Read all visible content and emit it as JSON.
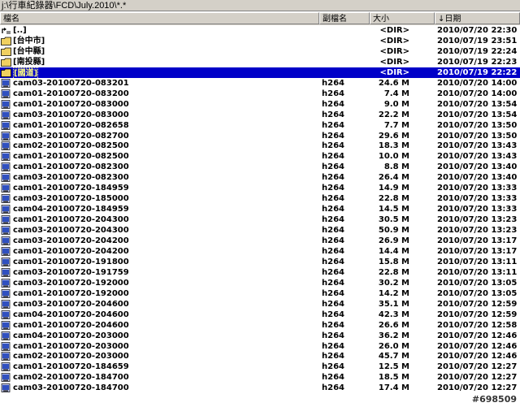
{
  "path": "j:\\行車紀錄器\\FCD\\July.2010\\*.*",
  "columns": {
    "name": "檔名",
    "ext": "副檔名",
    "size": "大小",
    "date": "↓日期"
  },
  "rows": [
    {
      "name": "[..]",
      "ext": "",
      "size": "<DIR>",
      "date": "2010/07/20 22:30",
      "icon": "up-folder-icon"
    },
    {
      "name": "[台中市]",
      "ext": "",
      "size": "<DIR>",
      "date": "2010/07/19 23:51",
      "icon": "folder-icon"
    },
    {
      "name": "[台中縣]",
      "ext": "",
      "size": "<DIR>",
      "date": "2010/07/19 22:24",
      "icon": "folder-icon"
    },
    {
      "name": "[南投縣]",
      "ext": "",
      "size": "<DIR>",
      "date": "2010/07/19 22:23",
      "icon": "folder-icon"
    },
    {
      "name": "[國道]",
      "ext": "",
      "size": "<DIR>",
      "date": "2010/07/19 22:22",
      "icon": "folder-icon"
    },
    {
      "name": "cam03-20100720-083201",
      "ext": "h264",
      "size": "24.6 M",
      "date": "2010/07/20 14:00",
      "icon": "file-icon"
    },
    {
      "name": "cam01-20100720-083200",
      "ext": "h264",
      "size": "7.4 M",
      "date": "2010/07/20 14:00",
      "icon": "file-icon"
    },
    {
      "name": "cam01-20100720-083000",
      "ext": "h264",
      "size": "9.0 M",
      "date": "2010/07/20 13:54",
      "icon": "file-icon"
    },
    {
      "name": "cam03-20100720-083000",
      "ext": "h264",
      "size": "22.2 M",
      "date": "2010/07/20 13:54",
      "icon": "file-icon"
    },
    {
      "name": "cam01-20100720-082658",
      "ext": "h264",
      "size": "7.7 M",
      "date": "2010/07/20 13:50",
      "icon": "file-icon"
    },
    {
      "name": "cam03-20100720-082700",
      "ext": "h264",
      "size": "29.6 M",
      "date": "2010/07/20 13:50",
      "icon": "file-icon"
    },
    {
      "name": "cam02-20100720-082500",
      "ext": "h264",
      "size": "18.3 M",
      "date": "2010/07/20 13:43",
      "icon": "file-icon"
    },
    {
      "name": "cam01-20100720-082500",
      "ext": "h264",
      "size": "10.0 M",
      "date": "2010/07/20 13:43",
      "icon": "file-icon"
    },
    {
      "name": "cam01-20100720-082300",
      "ext": "h264",
      "size": "8.8 M",
      "date": "2010/07/20 13:40",
      "icon": "file-icon"
    },
    {
      "name": "cam03-20100720-082300",
      "ext": "h264",
      "size": "26.4 M",
      "date": "2010/07/20 13:40",
      "icon": "file-icon"
    },
    {
      "name": "cam01-20100720-184959",
      "ext": "h264",
      "size": "14.9 M",
      "date": "2010/07/20 13:33",
      "icon": "file-icon"
    },
    {
      "name": "cam03-20100720-185000",
      "ext": "h264",
      "size": "22.8 M",
      "date": "2010/07/20 13:33",
      "icon": "file-icon"
    },
    {
      "name": "cam04-20100720-184959",
      "ext": "h264",
      "size": "14.5 M",
      "date": "2010/07/20 13:33",
      "icon": "file-icon"
    },
    {
      "name": "cam01-20100720-204300",
      "ext": "h264",
      "size": "30.5 M",
      "date": "2010/07/20 13:23",
      "icon": "file-icon"
    },
    {
      "name": "cam03-20100720-204300",
      "ext": "h264",
      "size": "50.9 M",
      "date": "2010/07/20 13:23",
      "icon": "file-icon"
    },
    {
      "name": "cam03-20100720-204200",
      "ext": "h264",
      "size": "26.9 M",
      "date": "2010/07/20 13:17",
      "icon": "file-icon"
    },
    {
      "name": "cam01-20100720-204200",
      "ext": "h264",
      "size": "14.4 M",
      "date": "2010/07/20 13:17",
      "icon": "file-icon"
    },
    {
      "name": "cam01-20100720-191800",
      "ext": "h264",
      "size": "15.8 M",
      "date": "2010/07/20 13:11",
      "icon": "file-icon"
    },
    {
      "name": "cam03-20100720-191759",
      "ext": "h264",
      "size": "22.8 M",
      "date": "2010/07/20 13:11",
      "icon": "file-icon"
    },
    {
      "name": "cam03-20100720-192000",
      "ext": "h264",
      "size": "30.2 M",
      "date": "2010/07/20 13:05",
      "icon": "file-icon"
    },
    {
      "name": "cam01-20100720-192000",
      "ext": "h264",
      "size": "14.2 M",
      "date": "2010/07/20 13:05",
      "icon": "file-icon"
    },
    {
      "name": "cam03-20100720-204600",
      "ext": "h264",
      "size": "35.1 M",
      "date": "2010/07/20 12:59",
      "icon": "file-icon"
    },
    {
      "name": "cam04-20100720-204600",
      "ext": "h264",
      "size": "42.3 M",
      "date": "2010/07/20 12:59",
      "icon": "file-icon"
    },
    {
      "name": "cam01-20100720-204600",
      "ext": "h264",
      "size": "26.6 M",
      "date": "2010/07/20 12:58",
      "icon": "file-icon"
    },
    {
      "name": "cam04-20100720-203000",
      "ext": "h264",
      "size": "36.2 M",
      "date": "2010/07/20 12:46",
      "icon": "file-icon"
    },
    {
      "name": "cam01-20100720-203000",
      "ext": "h264",
      "size": "26.0 M",
      "date": "2010/07/20 12:46",
      "icon": "file-icon"
    },
    {
      "name": "cam02-20100720-203000",
      "ext": "h264",
      "size": "45.7 M",
      "date": "2010/07/20 12:46",
      "icon": "file-icon"
    },
    {
      "name": "cam01-20100720-184659",
      "ext": "h264",
      "size": "12.5 M",
      "date": "2010/07/20 12:27",
      "icon": "file-icon"
    },
    {
      "name": "cam02-20100720-184700",
      "ext": "h264",
      "size": "18.5 M",
      "date": "2010/07/20 12:27",
      "icon": "file-icon"
    },
    {
      "name": "cam03-20100720-184700",
      "ext": "h264",
      "size": "17.4 M",
      "date": "2010/07/20 12:27",
      "icon": "file-icon"
    }
  ],
  "selected_index": 4,
  "watermark": "#698509",
  "colors": {
    "selection": "#0000c8",
    "folder": "#f0d060",
    "file": "#3050c0"
  }
}
